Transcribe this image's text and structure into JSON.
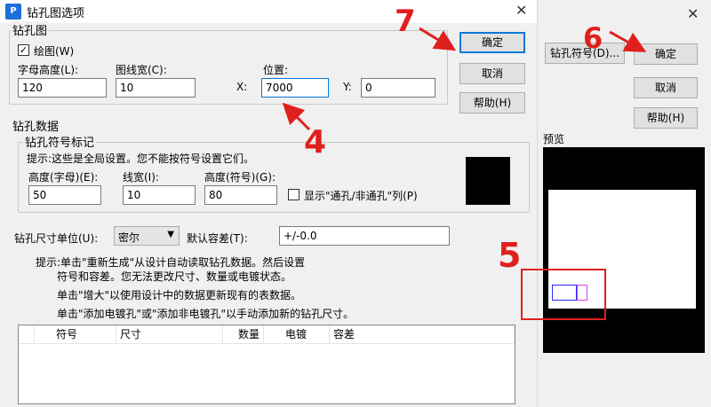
{
  "main_dialog": {
    "title": "钻孔图选项",
    "close_glyph": "✕",
    "drill_drawing": {
      "legend": "钻孔图",
      "draw_checkbox_label": "绘图(W)",
      "draw_checked": true,
      "char_height_label": "字母高度(L):",
      "char_height_value": "120",
      "line_width_label": "图线宽(C):",
      "line_width_value": "10",
      "position_label": "位置:",
      "x_label": "X:",
      "x_value": "7000",
      "y_label": "Y:",
      "y_value": "0"
    },
    "buttons": {
      "ok": "确定",
      "cancel": "取消",
      "help": "帮助(H)"
    },
    "drill_data": {
      "legend": "钻孔数据",
      "symbol_marks": {
        "legend": "钻孔符号标记",
        "hint": "提示:这些是全局设置。您不能按符号设置它们。",
        "height_char_label": "高度(字母)(E):",
        "height_char_value": "50",
        "line_width_label": "线宽(I):",
        "line_width_value": "10",
        "height_symbol_label": "高度(符号)(G):",
        "height_symbol_value": "80",
        "show_column_label": "显示\"通孔/非通孔\"列(P)",
        "show_column_checked": false
      },
      "size_unit_label": "钻孔尺寸单位(U):",
      "size_unit_value": "密尔",
      "tolerance_label": "默认容差(T):",
      "tolerance_value": "+/-0.0",
      "hints": [
        "提示:单击\"重新生成\"从设计自动读取钻孔数据。然后设置",
        "符号和容差。您无法更改尺寸、数量或电镀状态。",
        "单击\"增大\"以使用设计中的数据更新现有的表数据。",
        "单击\"添加电镀孔\"或\"添加非电镀孔\"以手动添加新的钻孔尺寸。"
      ],
      "table_headers": [
        "符号",
        "尺寸",
        "数量",
        "电镀",
        "容差"
      ]
    }
  },
  "side_dialog": {
    "close_glyph": "✕",
    "symbol_button": "钻孔符号(D)...",
    "ok": "确定",
    "cancel": "取消",
    "help": "帮助(H)",
    "preview_label": "预览"
  },
  "annotations": [
    "4",
    "5",
    "6",
    "7"
  ],
  "colors": {
    "annotation_red": "#e0201e",
    "default_button_border": "#0078d7",
    "preview_bg": "#000000",
    "marker_blue": "#2a2aff",
    "marker_magenta": "#e040e0"
  }
}
